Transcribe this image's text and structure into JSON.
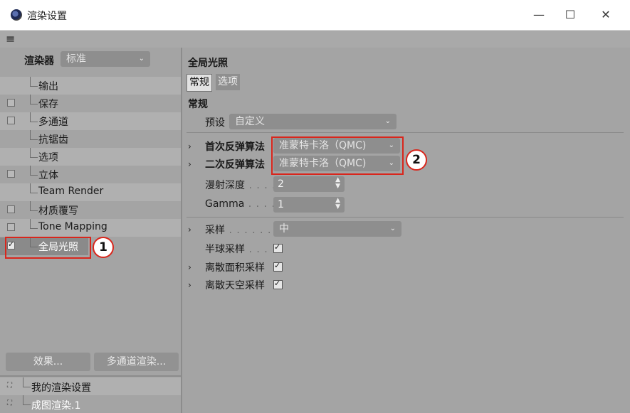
{
  "window": {
    "title": "渲染设置",
    "minimize": "—",
    "maximize": "☐",
    "close": "✕"
  },
  "menu": {
    "hamburger": "≡"
  },
  "left": {
    "renderer_label": "渲染器",
    "renderer_value": "标准",
    "items": [
      {
        "label": "输出",
        "checkbox": false,
        "checked": false
      },
      {
        "label": "保存",
        "checkbox": true,
        "checked": false
      },
      {
        "label": "多通道",
        "checkbox": true,
        "checked": false
      },
      {
        "label": "抗锯齿",
        "checkbox": false,
        "checked": false
      },
      {
        "label": "选项",
        "checkbox": false,
        "checked": false
      },
      {
        "label": "立体",
        "checkbox": true,
        "checked": false
      },
      {
        "label": "Team Render",
        "checkbox": false,
        "checked": false
      },
      {
        "label": "材质覆写",
        "checkbox": true,
        "checked": false
      },
      {
        "label": "Tone Mapping",
        "checkbox": true,
        "checked": false
      },
      {
        "label": "全局光照",
        "checkbox": true,
        "checked": true
      }
    ],
    "effects_button": "效果...",
    "multipass_button": "多通道渲染...",
    "presets": [
      {
        "label": "我的渲染设置"
      },
      {
        "label": "成图渲染.1"
      }
    ],
    "annotation": "1"
  },
  "right": {
    "section_title": "全局光照",
    "tabs": [
      "常规",
      "选项"
    ],
    "group_title": "常规",
    "preset_label": "预设",
    "preset_value": "自定义",
    "primary_label": "首次反弹算法",
    "primary_value": "准蒙特卡洛（QMC)",
    "secondary_label": "二次反弹算法",
    "secondary_value": "准蒙特卡洛（QMC)",
    "diffuse_depth_label": "漫射深度",
    "diffuse_depth_value": "2",
    "gamma_label": "Gamma",
    "gamma_value": "1",
    "sampling_label": "采样",
    "sampling_value": "中",
    "hemi_label": "半球采样",
    "discrete_area_label": "离散面积采样",
    "discrete_sky_label": "离散天空采样",
    "annotation": "2"
  },
  "colors": {
    "panel": "#a4a4a4",
    "annotation_red": "#d9261c"
  }
}
